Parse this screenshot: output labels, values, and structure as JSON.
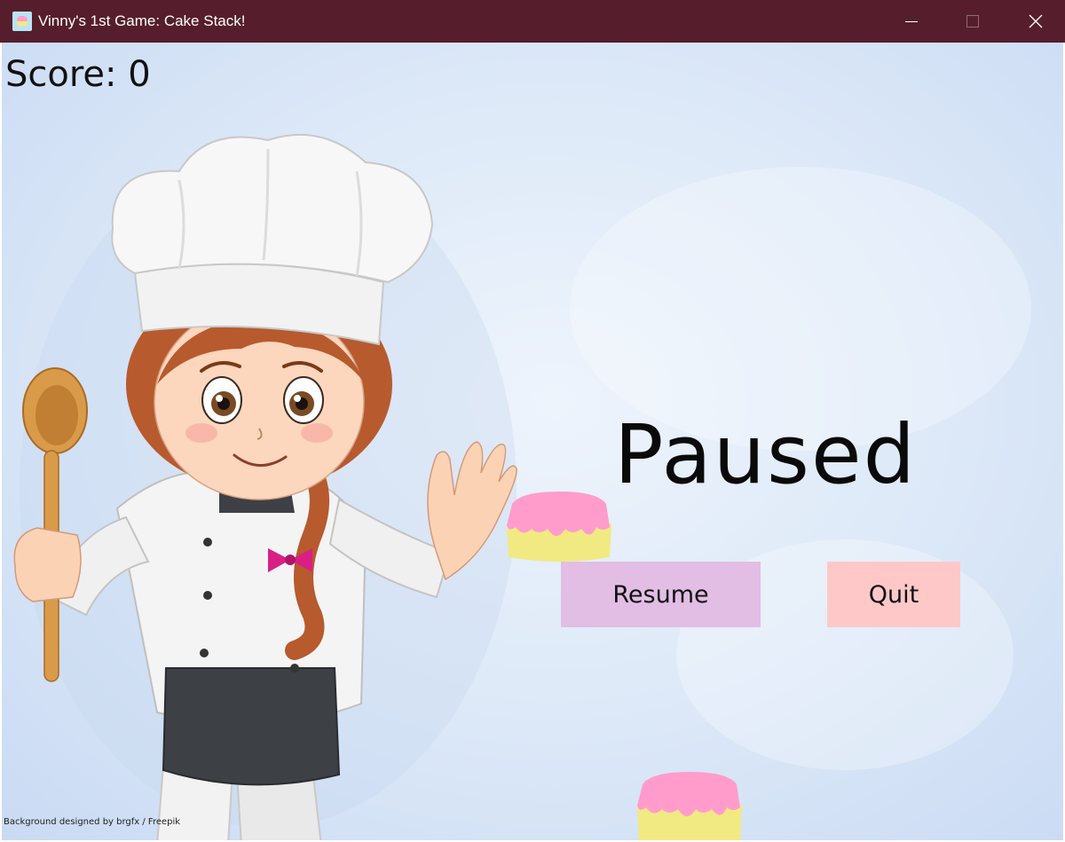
{
  "window": {
    "title": "Vinny's 1st Game: Cake Stack!",
    "titlebar_color": "#561e2c"
  },
  "game": {
    "score_text": "Score: 0",
    "pause_title": "Paused",
    "resume_label": "Resume",
    "quit_label": "Quit",
    "resume_color": "#e2bde4",
    "quit_color": "#ffc8c8",
    "credit": "Background designed by brgfx / Freepik",
    "cake_frosting_color": "#ff9ccc",
    "cake_sponge_color": "#f1ea82"
  }
}
